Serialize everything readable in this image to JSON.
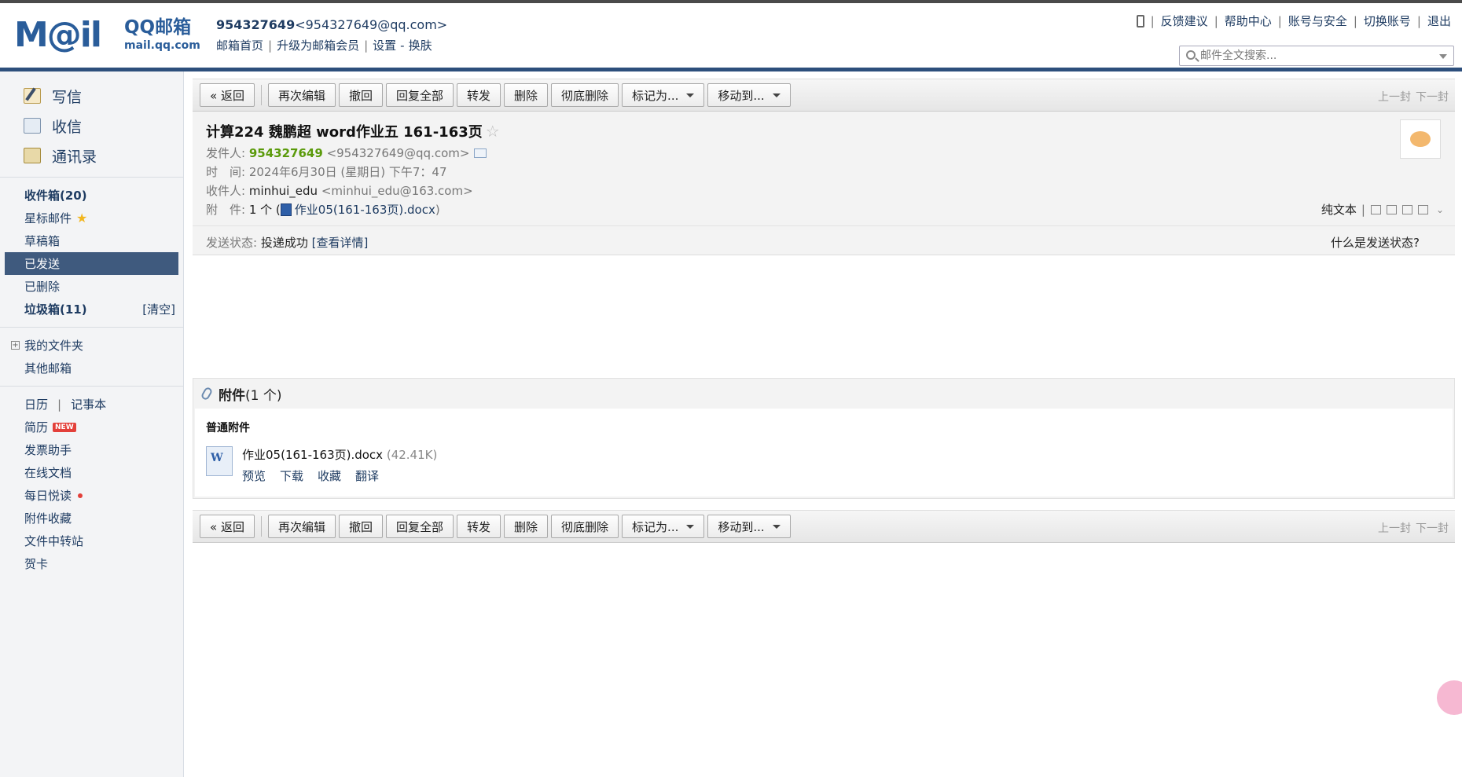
{
  "header": {
    "logo_text": "M@il",
    "logo_name": "QQ邮箱",
    "logo_url": "mail.qq.com",
    "account_name": "954327649",
    "account_email": "<954327649@qq.com>",
    "links": [
      "邮箱首页",
      "升级为邮箱会员",
      "设置",
      "换肤"
    ],
    "settings_dash": "-",
    "top_links": [
      "反馈建议",
      "帮助中心",
      "账号与安全",
      "切换账号",
      "退出"
    ],
    "search_placeholder": "邮件全文搜索..."
  },
  "sidebar": {
    "write": "写信",
    "receive": "收信",
    "contacts": "通讯录",
    "inbox": "收件箱(20)",
    "starred": "星标邮件",
    "drafts": "草稿箱",
    "sent": "已发送",
    "deleted": "已删除",
    "spam": "垃圾箱(11)",
    "spam_clear": "[清空]",
    "my_folders": "我的文件夹",
    "other_mail": "其他邮箱",
    "calendar": "日历",
    "notes": "记事本",
    "resume": "简历",
    "resume_badge": "NEW",
    "invoice": "发票助手",
    "docs": "在线文档",
    "daily": "每日悦读",
    "att_fav": "附件收藏",
    "transfer": "文件中转站",
    "card": "贺卡"
  },
  "toolbar": {
    "back": "« 返回",
    "reedit": "再次编辑",
    "recall": "撤回",
    "reply_all": "回复全部",
    "forward": "转发",
    "delete": "删除",
    "delete_perm": "彻底删除",
    "mark_as": "标记为...",
    "move_to": "移动到...",
    "prev": "上一封",
    "next": "下一封"
  },
  "mail": {
    "subject": "计算224 魏鹏超 word作业五 161-163页",
    "from_label": "发件人:",
    "from_name": "954327649",
    "from_addr": "<954327649@qq.com>",
    "time_label": "时　间:",
    "time": "2024年6月30日 (星期日) 下午7：47",
    "to_label": "收件人:",
    "to_name": "minhui_edu",
    "to_addr": "<minhui_edu@163.com>",
    "att_label": "附　件:",
    "att_count": "1 个 (",
    "att_file": "作业05(161-163页).docx",
    "att_close": ")",
    "plain_text": "纯文本",
    "status_label": "发送状态:",
    "status_value": "投递成功",
    "status_detail": "[查看详情]",
    "status_help": "什么是发送状态?"
  },
  "attachments": {
    "title": "附件",
    "count": "(1 个)",
    "section": "普通附件",
    "file_name": "作业05(161-163页).docx",
    "file_size": "(42.41K)",
    "actions": [
      "预览",
      "下载",
      "收藏",
      "翻译"
    ]
  }
}
